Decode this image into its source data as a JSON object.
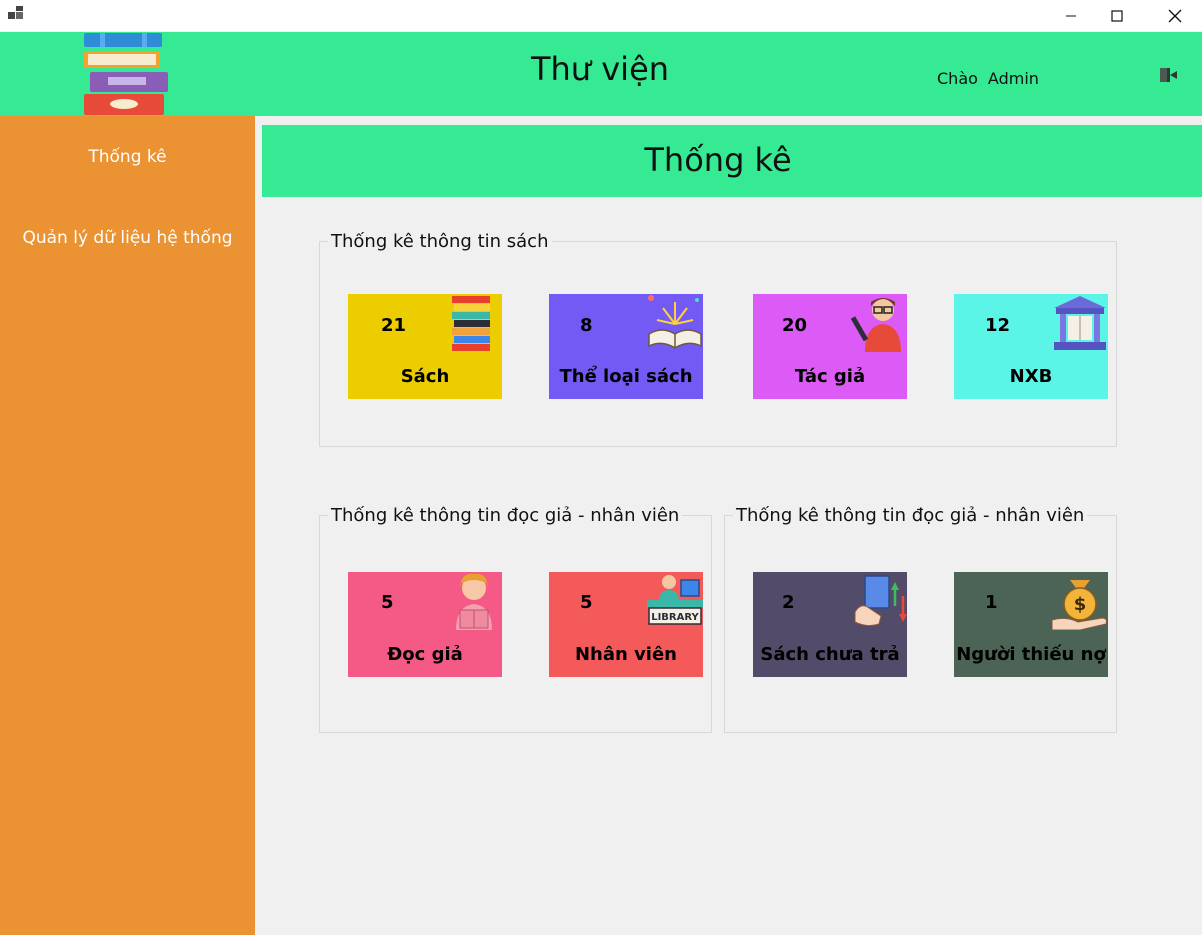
{
  "window": {
    "minimize": "minimize",
    "maximize": "maximize",
    "close": "close"
  },
  "header": {
    "title": "Thư viện",
    "greeting": "Chào",
    "user": "Admin"
  },
  "sidebar": {
    "items": [
      {
        "label": "Thống kê"
      },
      {
        "label": "Quản lý dữ liệu hệ thống"
      }
    ]
  },
  "page": {
    "title": "Thống kê"
  },
  "groups": {
    "books": {
      "title": "Thống kê thông tin sách",
      "cards": [
        {
          "count": "21",
          "label": "Sách",
          "color": "#eccd00",
          "icon": "books-stack-icon"
        },
        {
          "count": "8",
          "label": "Thể loại sách",
          "color": "#735af5",
          "icon": "open-book-icon"
        },
        {
          "count": "20",
          "label": "Tác giả",
          "color": "#dc5af5",
          "icon": "author-icon"
        },
        {
          "count": "12",
          "label": "NXB",
          "color": "#5af5e6",
          "icon": "publisher-building-icon"
        }
      ]
    },
    "people": {
      "title": "Thống kê thông tin đọc giả - nhân viên",
      "cards": [
        {
          "count": "5",
          "label": "Đọc giả",
          "color": "#f55a87",
          "icon": "reader-icon"
        },
        {
          "count": "5",
          "label": "Nhân viên",
          "color": "#f55a5a",
          "icon": "librarian-icon"
        }
      ]
    },
    "loans": {
      "title": "Thống kê thông tin đọc giả - nhân viên",
      "cards": [
        {
          "count": "2",
          "label": "Sách chưa trả",
          "color": "#524b69",
          "icon": "book-return-icon"
        },
        {
          "count": "1",
          "label": "Người thiếu nợ",
          "color": "#4b6455",
          "icon": "money-bag-icon"
        }
      ]
    }
  }
}
